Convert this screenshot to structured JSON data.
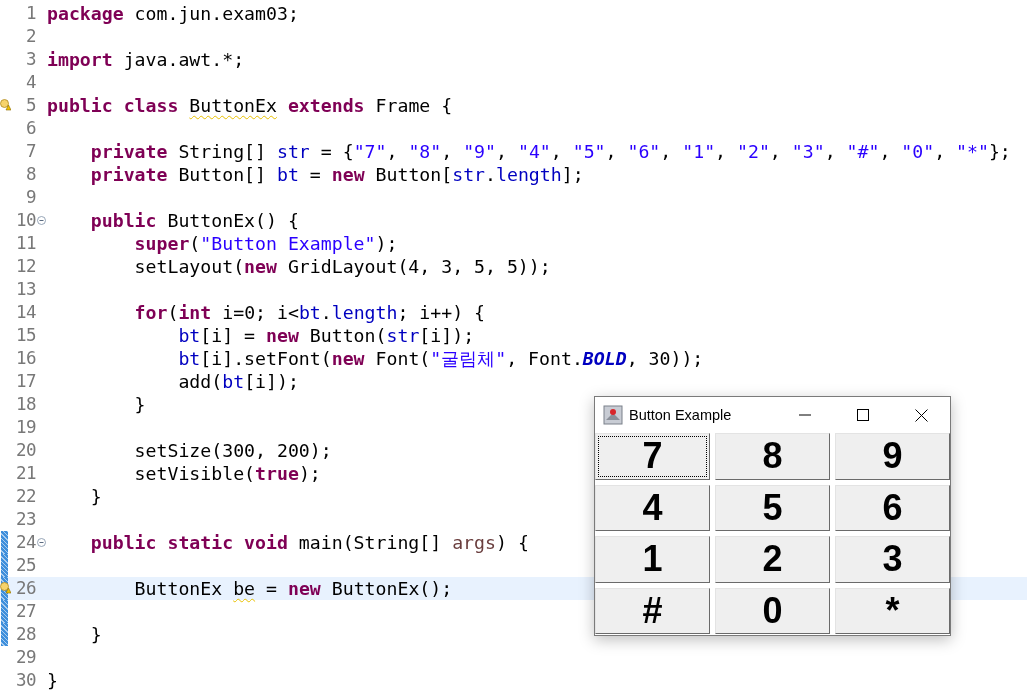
{
  "editor": {
    "lines": [
      {
        "number": "1",
        "tokens": [
          {
            "kind": "keyword",
            "text": "package"
          },
          {
            "kind": "plain",
            "text": " com.jun.exam03;"
          }
        ]
      },
      {
        "number": "2"
      },
      {
        "number": "3",
        "tokens": [
          {
            "kind": "keyword",
            "text": "import"
          },
          {
            "kind": "plain",
            "text": " java.awt.*;"
          }
        ]
      },
      {
        "number": "4"
      },
      {
        "number": "5",
        "warning_marker": true,
        "tokens": [
          {
            "kind": "keyword",
            "text": "public class "
          },
          {
            "kind": "plain",
            "text": "ButtonEx",
            "warning": true
          },
          {
            "kind": "keyword",
            "text": " extends"
          },
          {
            "kind": "plain",
            "text": " Frame {"
          }
        ]
      },
      {
        "number": "6"
      },
      {
        "number": "7",
        "tokens": [
          {
            "kind": "keyword",
            "text": "    private"
          },
          {
            "kind": "plain",
            "text": " String[] "
          },
          {
            "kind": "field",
            "text": "str"
          },
          {
            "kind": "plain",
            "text": " = {"
          },
          {
            "kind": "string",
            "text": "\"7\""
          },
          {
            "kind": "plain",
            "text": ", "
          },
          {
            "kind": "string",
            "text": "\"8\""
          },
          {
            "kind": "plain",
            "text": ", "
          },
          {
            "kind": "string",
            "text": "\"9\""
          },
          {
            "kind": "plain",
            "text": ", "
          },
          {
            "kind": "string",
            "text": "\"4\""
          },
          {
            "kind": "plain",
            "text": ", "
          },
          {
            "kind": "string",
            "text": "\"5\""
          },
          {
            "kind": "plain",
            "text": ", "
          },
          {
            "kind": "string",
            "text": "\"6\""
          },
          {
            "kind": "plain",
            "text": ", "
          },
          {
            "kind": "string",
            "text": "\"1\""
          },
          {
            "kind": "plain",
            "text": ", "
          },
          {
            "kind": "string",
            "text": "\"2\""
          },
          {
            "kind": "plain",
            "text": ", "
          },
          {
            "kind": "string",
            "text": "\"3\""
          },
          {
            "kind": "plain",
            "text": ", "
          },
          {
            "kind": "string",
            "text": "\"#\""
          },
          {
            "kind": "plain",
            "text": ", "
          },
          {
            "kind": "string",
            "text": "\"0\""
          },
          {
            "kind": "plain",
            "text": ", "
          },
          {
            "kind": "string",
            "text": "\"*\""
          },
          {
            "kind": "plain",
            "text": "};"
          }
        ]
      },
      {
        "number": "8",
        "tokens": [
          {
            "kind": "keyword",
            "text": "    private"
          },
          {
            "kind": "plain",
            "text": " Button[] "
          },
          {
            "kind": "field",
            "text": "bt"
          },
          {
            "kind": "plain",
            "text": " = "
          },
          {
            "kind": "keyword",
            "text": "new"
          },
          {
            "kind": "plain",
            "text": " Button["
          },
          {
            "kind": "field",
            "text": "str"
          },
          {
            "kind": "plain",
            "text": "."
          },
          {
            "kind": "field",
            "text": "length"
          },
          {
            "kind": "plain",
            "text": "];"
          }
        ]
      },
      {
        "number": "9"
      },
      {
        "number": "10",
        "foldable": true,
        "tokens": [
          {
            "kind": "keyword",
            "text": "    public"
          },
          {
            "kind": "plain",
            "text": " ButtonEx() {"
          }
        ]
      },
      {
        "number": "11",
        "tokens": [
          {
            "kind": "keyword",
            "text": "        super"
          },
          {
            "kind": "plain",
            "text": "("
          },
          {
            "kind": "string",
            "text": "\"Button Example\""
          },
          {
            "kind": "plain",
            "text": ");"
          }
        ]
      },
      {
        "number": "12",
        "tokens": [
          {
            "kind": "plain",
            "text": "        setLayout("
          },
          {
            "kind": "keyword",
            "text": "new"
          },
          {
            "kind": "plain",
            "text": " GridLayout(4, 3, 5, 5));"
          }
        ]
      },
      {
        "number": "13"
      },
      {
        "number": "14",
        "tokens": [
          {
            "kind": "keyword",
            "text": "        for"
          },
          {
            "kind": "plain",
            "text": "("
          },
          {
            "kind": "keyword",
            "text": "int"
          },
          {
            "kind": "plain",
            "text": " i=0; i<"
          },
          {
            "kind": "field",
            "text": "bt"
          },
          {
            "kind": "plain",
            "text": "."
          },
          {
            "kind": "field",
            "text": "length"
          },
          {
            "kind": "plain",
            "text": "; i++) {"
          }
        ]
      },
      {
        "number": "15",
        "tokens": [
          {
            "kind": "field",
            "text": "            bt"
          },
          {
            "kind": "plain",
            "text": "[i] = "
          },
          {
            "kind": "keyword",
            "text": "new"
          },
          {
            "kind": "plain",
            "text": " Button("
          },
          {
            "kind": "field",
            "text": "str"
          },
          {
            "kind": "plain",
            "text": "[i]);"
          }
        ]
      },
      {
        "number": "16",
        "tokens": [
          {
            "kind": "field",
            "text": "            bt"
          },
          {
            "kind": "plain",
            "text": "[i].setFont("
          },
          {
            "kind": "keyword",
            "text": "new"
          },
          {
            "kind": "plain",
            "text": " Font("
          },
          {
            "kind": "string",
            "text": "\"굴림체\""
          },
          {
            "kind": "plain",
            "text": ", Font."
          },
          {
            "kind": "constant",
            "text": "BOLD"
          },
          {
            "kind": "plain",
            "text": ", 30));"
          }
        ]
      },
      {
        "number": "17",
        "tokens": [
          {
            "kind": "plain",
            "text": "            add("
          },
          {
            "kind": "field",
            "text": "bt"
          },
          {
            "kind": "plain",
            "text": "[i]);"
          }
        ]
      },
      {
        "number": "18",
        "tokens": [
          {
            "kind": "plain",
            "text": "        }"
          }
        ]
      },
      {
        "number": "19"
      },
      {
        "number": "20",
        "tokens": [
          {
            "kind": "plain",
            "text": "        setSize(300, 200);"
          }
        ]
      },
      {
        "number": "21",
        "tokens": [
          {
            "kind": "plain",
            "text": "        setVisible("
          },
          {
            "kind": "keyword",
            "text": "true"
          },
          {
            "kind": "plain",
            "text": ");"
          }
        ]
      },
      {
        "number": "22",
        "tokens": [
          {
            "kind": "plain",
            "text": "    }"
          }
        ]
      },
      {
        "number": "23"
      },
      {
        "number": "24",
        "foldable": true,
        "changed": true,
        "tokens": [
          {
            "kind": "keyword",
            "text": "    public static void"
          },
          {
            "kind": "plain",
            "text": " main(String[] "
          },
          {
            "kind": "parameter",
            "text": "args"
          },
          {
            "kind": "plain",
            "text": ") {"
          }
        ]
      },
      {
        "number": "25",
        "changed": true
      },
      {
        "number": "26",
        "warning_marker": true,
        "changed": true,
        "current": true,
        "tokens": [
          {
            "kind": "plain",
            "text": "        ButtonEx "
          },
          {
            "kind": "plain",
            "text": "be",
            "warning": true
          },
          {
            "kind": "plain",
            "text": " = "
          },
          {
            "kind": "keyword",
            "text": "new"
          },
          {
            "kind": "plain",
            "text": " ButtonEx();"
          }
        ]
      },
      {
        "number": "27",
        "changed": true
      },
      {
        "number": "28",
        "changed": true,
        "tokens": [
          {
            "kind": "plain",
            "text": "    }"
          }
        ]
      },
      {
        "number": "29"
      },
      {
        "number": "30",
        "tokens": [
          {
            "kind": "plain",
            "text": "}"
          }
        ]
      }
    ]
  },
  "frame": {
    "title": "Button Example",
    "buttons": [
      {
        "label": "7",
        "focused": true
      },
      {
        "label": "8",
        "focused": false
      },
      {
        "label": "9",
        "focused": false
      },
      {
        "label": "4",
        "focused": false
      },
      {
        "label": "5",
        "focused": false
      },
      {
        "label": "6",
        "focused": false
      },
      {
        "label": "1",
        "focused": false
      },
      {
        "label": "2",
        "focused": false
      },
      {
        "label": "3",
        "focused": false
      },
      {
        "label": "#",
        "focused": false
      },
      {
        "label": "0",
        "focused": false
      },
      {
        "label": "*",
        "focused": false
      }
    ]
  }
}
